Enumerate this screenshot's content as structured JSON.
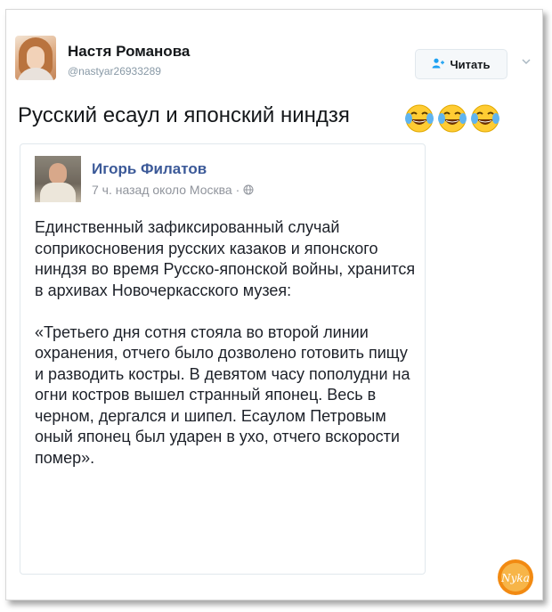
{
  "tweet": {
    "author_name": "Настя Романова",
    "author_handle": "@nastyar26933289",
    "follow_label": "Читать",
    "text": "Русский есаул и японский ниндзя",
    "emojis": [
      "face-with-tears-of-joy",
      "face-with-tears-of-joy",
      "face-with-tears-of-joy"
    ]
  },
  "embed": {
    "author_name": "Игорь Филатов",
    "meta": "7 ч. назад около Москва ·",
    "paragraph1": "Единственный зафиксированный случай соприкосновения русских казаков и японского ниндзя во время Русско-японской войны, хранится в архивах Новочеркасского музея:",
    "paragraph2": "«Третьего дня сотня стояла во второй линии охранения, отчего было дозволено готовить пищу и разводить костры. В девятом часу пополудни на огни костров вышел странный японец. Весь в черном, дергался и шипел. Есаулом Петровым оный японец был ударен в ухо, отчего вскорости помер»."
  },
  "watermark_text": "Nyka",
  "colors": {
    "fb_blue": "#3b5998",
    "twitter_blue": "#1da1f2",
    "muted": "#8899a6"
  }
}
